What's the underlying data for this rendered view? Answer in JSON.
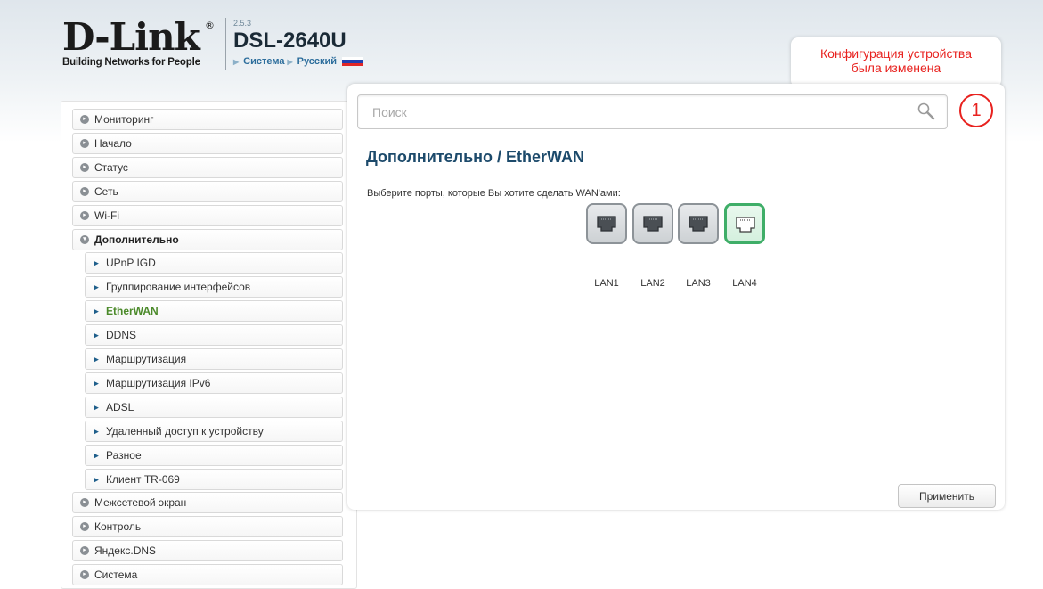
{
  "header": {
    "logo_text": "D-Link",
    "logo_registered": "®",
    "logo_tagline": "Building Networks for People",
    "firmware_version": "2.5.3",
    "model": "DSL-2640U",
    "nav": [
      "Система",
      "Русский"
    ],
    "flag_colors": [
      "#ffffff",
      "#1f3fb0",
      "#e02626"
    ]
  },
  "notification": {
    "line1": "Конфигурация устройства",
    "line2": "была изменена",
    "badge_count": "1"
  },
  "search": {
    "placeholder": "Поиск"
  },
  "sidebar": {
    "items": [
      {
        "label": "Мониторинг"
      },
      {
        "label": "Начало"
      },
      {
        "label": "Статус"
      },
      {
        "label": "Сеть"
      },
      {
        "label": "Wi-Fi"
      },
      {
        "label": "Дополнительно",
        "expanded": true
      },
      {
        "label": "Межсетевой экран"
      },
      {
        "label": "Контроль"
      },
      {
        "label": "Яндекс.DNS"
      },
      {
        "label": "Система"
      }
    ],
    "subitems": [
      {
        "label": "UPnP IGD"
      },
      {
        "label": "Группирование интерфейсов"
      },
      {
        "label": "EtherWAN",
        "active": true
      },
      {
        "label": "DDNS"
      },
      {
        "label": "Маршрутизация"
      },
      {
        "label": "Маршрутизация IPv6"
      },
      {
        "label": "ADSL"
      },
      {
        "label": "Удаленный доступ к устройству"
      },
      {
        "label": "Разное"
      },
      {
        "label": "Клиент TR-069"
      }
    ]
  },
  "main": {
    "title": "Дополнительно /  EtherWAN",
    "instruction": "Выберите порты, которые Вы хотите сделать WAN'ами:",
    "ports": [
      {
        "label": "LAN1",
        "selected": false
      },
      {
        "label": "LAN2",
        "selected": false
      },
      {
        "label": "LAN3",
        "selected": false
      },
      {
        "label": "LAN4",
        "selected": true
      }
    ],
    "apply_label": "Применить"
  },
  "colors": {
    "accent_blue": "#1c4a6b",
    "alert_red": "#e8221f",
    "active_green": "#4b8a2a",
    "port_selected": "#3fae68"
  }
}
